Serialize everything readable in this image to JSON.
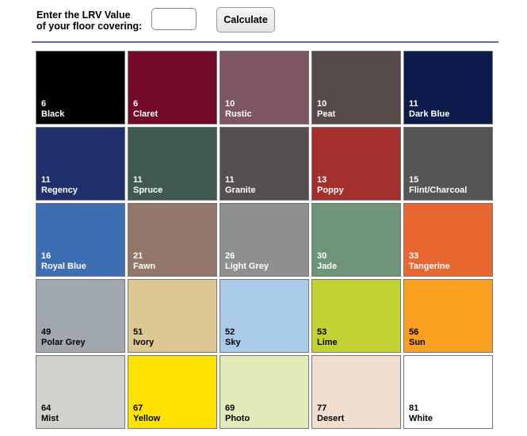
{
  "form": {
    "label_line1": "Enter the LRV Value",
    "label_line2": "of your floor covering:",
    "input_value": "",
    "button_label": "Calculate"
  },
  "swatches": [
    {
      "lrv": "6",
      "name": "Black",
      "color": "#000000",
      "text": "light"
    },
    {
      "lrv": "6",
      "name": "Claret",
      "color": "#740a28",
      "text": "light"
    },
    {
      "lrv": "10",
      "name": "Rustic",
      "color": "#7d5661",
      "text": "light"
    },
    {
      "lrv": "10",
      "name": "Peat",
      "color": "#574b49",
      "text": "light"
    },
    {
      "lrv": "11",
      "name": "Dark Blue",
      "color": "#0c1b4c",
      "text": "light"
    },
    {
      "lrv": "11",
      "name": "Regency",
      "color": "#1f306c",
      "text": "light"
    },
    {
      "lrv": "11",
      "name": "Spruce",
      "color": "#3f5a50",
      "text": "light"
    },
    {
      "lrv": "11",
      "name": "Granite",
      "color": "#564f4f",
      "text": "light"
    },
    {
      "lrv": "13",
      "name": "Poppy",
      "color": "#a3302c",
      "text": "light"
    },
    {
      "lrv": "15",
      "name": "Flint/Charcoal",
      "color": "#545655",
      "text": "light"
    },
    {
      "lrv": "16",
      "name": "Royal Blue",
      "color": "#3d6db3",
      "text": "light"
    },
    {
      "lrv": "21",
      "name": "Fawn",
      "color": "#93776b",
      "text": "light"
    },
    {
      "lrv": "26",
      "name": "Light Grey",
      "color": "#8f8f8f",
      "text": "light"
    },
    {
      "lrv": "30",
      "name": "Jade",
      "color": "#6e957a",
      "text": "light"
    },
    {
      "lrv": "33",
      "name": "Tangerine",
      "color": "#e86731",
      "text": "light"
    },
    {
      "lrv": "49",
      "name": "Polar Grey",
      "color": "#a1a7ae",
      "text": "dark"
    },
    {
      "lrv": "51",
      "name": "Ivory",
      "color": "#ddc793",
      "text": "dark"
    },
    {
      "lrv": "52",
      "name": "Sky",
      "color": "#a9cbe9",
      "text": "dark"
    },
    {
      "lrv": "53",
      "name": "Lime",
      "color": "#c2d331",
      "text": "dark"
    },
    {
      "lrv": "56",
      "name": "Sun",
      "color": "#f9a021",
      "text": "dark"
    },
    {
      "lrv": "64",
      "name": "Mist",
      "color": "#d3d1ce",
      "text": "dark"
    },
    {
      "lrv": "67",
      "name": "Yellow",
      "color": "#ffe200",
      "text": "dark"
    },
    {
      "lrv": "69",
      "name": "Photo",
      "color": "#e3eab9",
      "text": "dark"
    },
    {
      "lrv": "77",
      "name": "Desert",
      "color": "#f0dfd0",
      "text": "dark"
    },
    {
      "lrv": "81",
      "name": "White",
      "color": "#ffffff",
      "text": "dark"
    }
  ]
}
